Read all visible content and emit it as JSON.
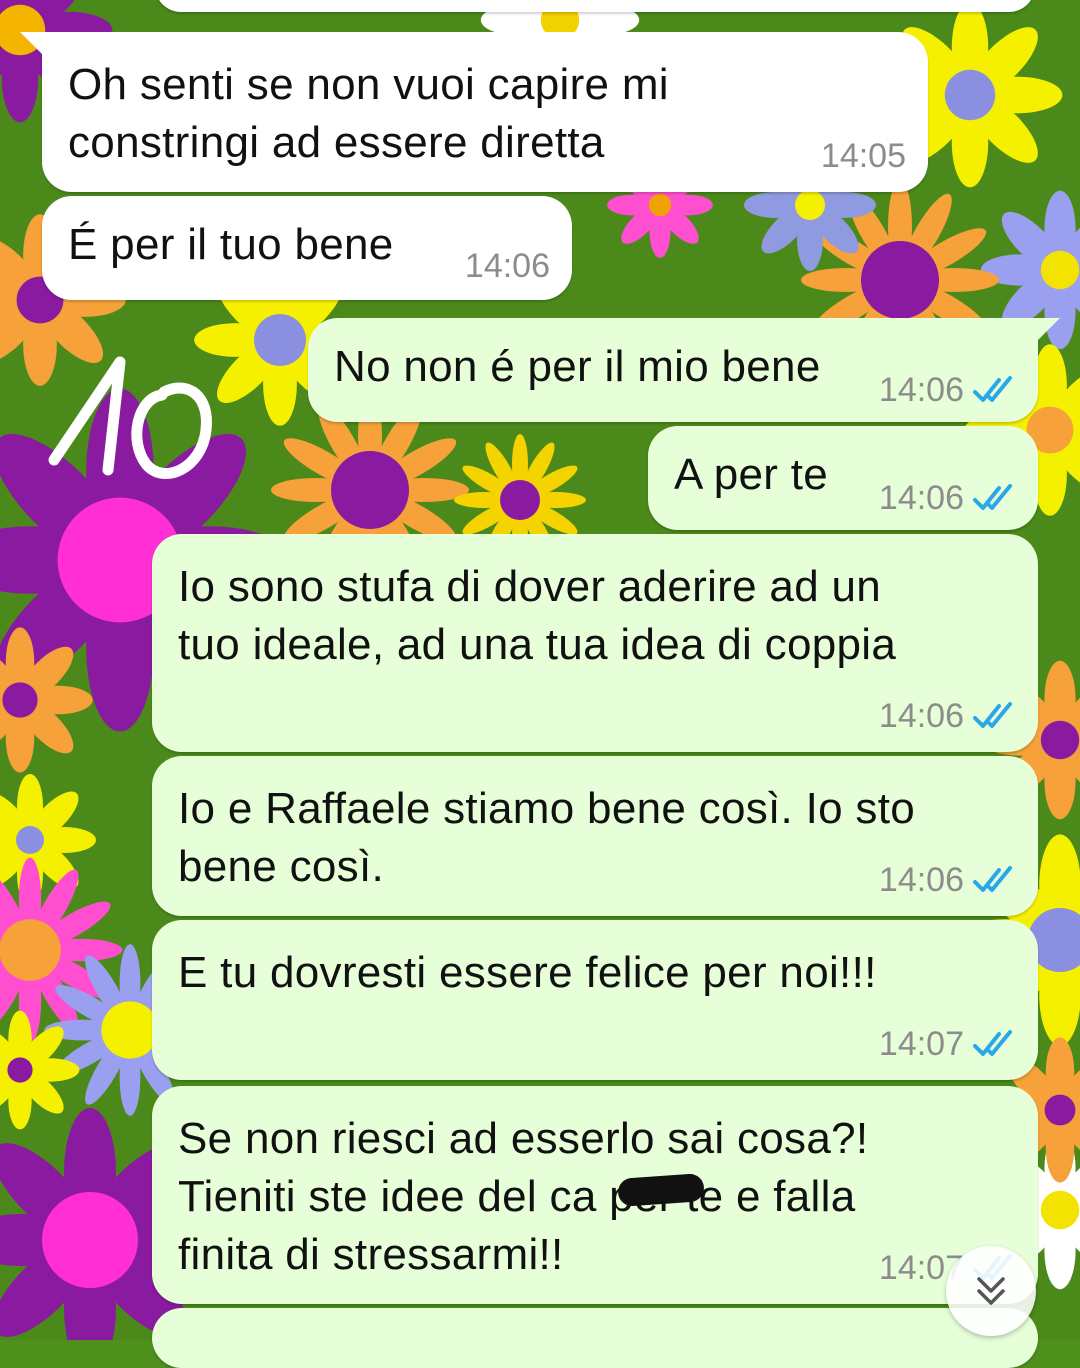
{
  "chat": {
    "messages": [
      {
        "direction": "in",
        "text": "Oh senti se non vuoi capire mi\nconstringi ad essere diretta",
        "time": "14:05",
        "read": false
      },
      {
        "direction": "in",
        "text": "É per il tuo bene",
        "time": "14:06",
        "read": false
      },
      {
        "direction": "out",
        "text": "No non é per il mio bene",
        "time": "14:06",
        "read": true
      },
      {
        "direction": "out",
        "text": "A per te",
        "time": "14:06",
        "read": true
      },
      {
        "direction": "out",
        "text": "Io sono stufa di dover aderire ad un\ntuo ideale, ad una tua idea di coppia",
        "time": "14:06",
        "read": true
      },
      {
        "direction": "out",
        "text": "Io e Raffaele stiamo bene così. Io sto\nbene così.",
        "time": "14:06",
        "read": true
      },
      {
        "direction": "out",
        "text": "E tu dovresti essere felice per noi!!!",
        "time": "14:07",
        "read": true
      },
      {
        "direction": "out",
        "text": "Se non riesci ad esserlo sai cosa?!\nTieniti ste idee del ca      per te e falla\nfinita di stressarmi!!",
        "time": "14:07",
        "read": true
      }
    ]
  },
  "annotation": {
    "handwritten_number": "10"
  },
  "icons": {
    "read_receipt": "double-check-icon",
    "scroll_down": "chevron-double-down-icon"
  },
  "colors": {
    "incoming_bubble": "#ffffff",
    "outgoing_bubble": "#e6ffd8",
    "read_tick": "#2aa7e8",
    "timestamp": "#8c8c8c",
    "wallpaper_green": "#4f8f1c"
  }
}
